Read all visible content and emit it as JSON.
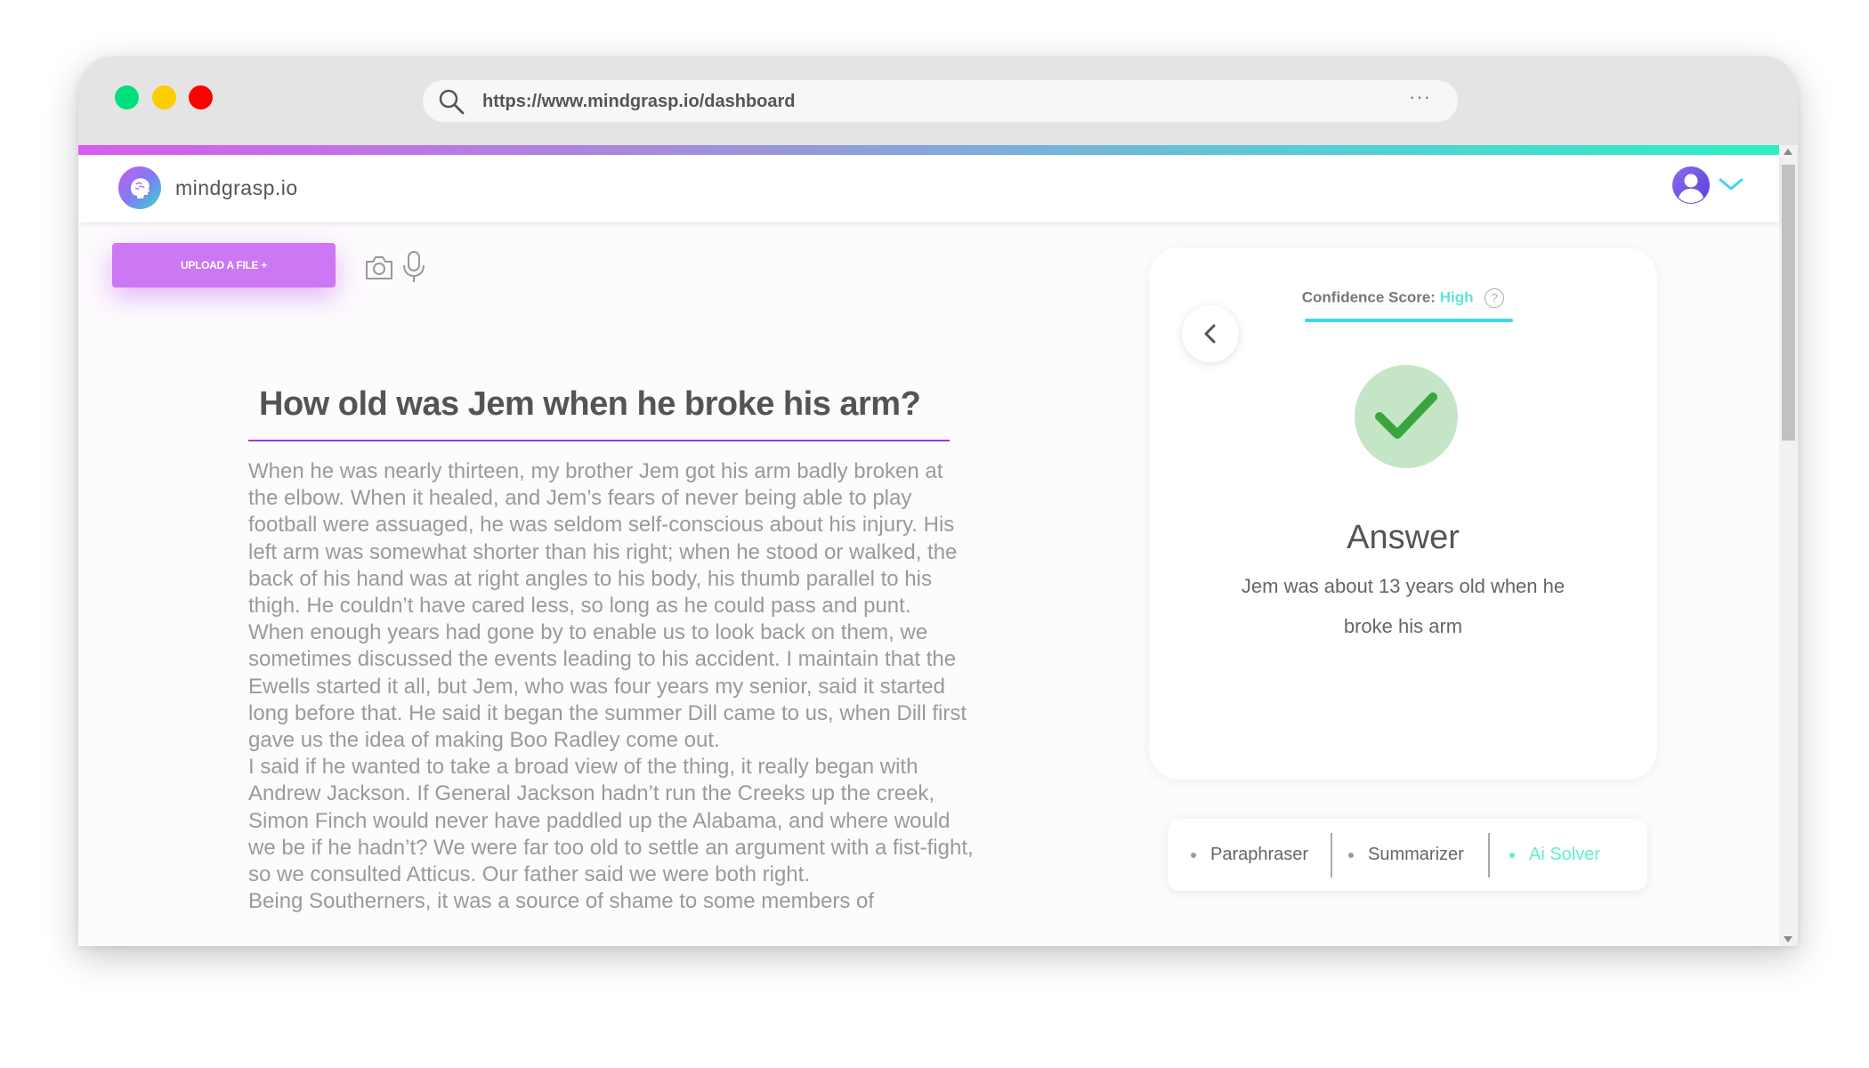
{
  "browser": {
    "url": "https://www.mindgrasp.io/dashboard",
    "more_label": "···"
  },
  "app": {
    "brand": "mindgrasp.io"
  },
  "toolbar": {
    "upload_label": "UPLOAD A FILE +"
  },
  "question": "How old was Jem when he broke his arm?",
  "passage": [
    "When he was nearly thirteen, my brother Jem got his arm badly broken at the elbow. When it healed, and Jem’s fears of never being able to play football were assuaged, he was seldom self-conscious about his injury. His left arm was somewhat shorter than his right; when he stood or walked, the back of his hand was at right angles to his body, his thumb parallel to his thigh. He couldn’t have cared less, so long as he could pass and punt.",
    "When enough years had gone by to enable us to look back on them, we sometimes discussed the events leading to his accident. I maintain that the Ewells started it all, but Jem, who was four years my senior, said it started long before that. He said it began the summer Dill came to us, when Dill first gave us the idea of making Boo Radley come out.",
    "I said if he wanted to take a broad view of the thing, it really began with Andrew Jackson. If General Jackson hadn’t run the Creeks up the creek, Simon Finch would never have paddled up the Alabama, and where would we be if he hadn’t? We were far too old to settle an argument with a fist-fight, so we consulted Atticus. Our father said we were both right.",
    "Being Southerners, it was a source of shame to some members of"
  ],
  "answer_card": {
    "confidence_label": "Confidence Score:",
    "confidence_value": "High",
    "help_label": "?",
    "back_label": "‹",
    "answer_title": "Answer",
    "answer_text": "Jem was about 13 years old when he broke his arm"
  },
  "tools": [
    {
      "label": "Paraphraser",
      "active": false
    },
    {
      "label": "Summarizer",
      "active": false
    },
    {
      "label": "Ai Solver",
      "active": true
    }
  ],
  "colors": {
    "accent_purple": "#cc77f4",
    "accent_teal": "#5ef0d0",
    "check_green": "#3aa53e"
  }
}
